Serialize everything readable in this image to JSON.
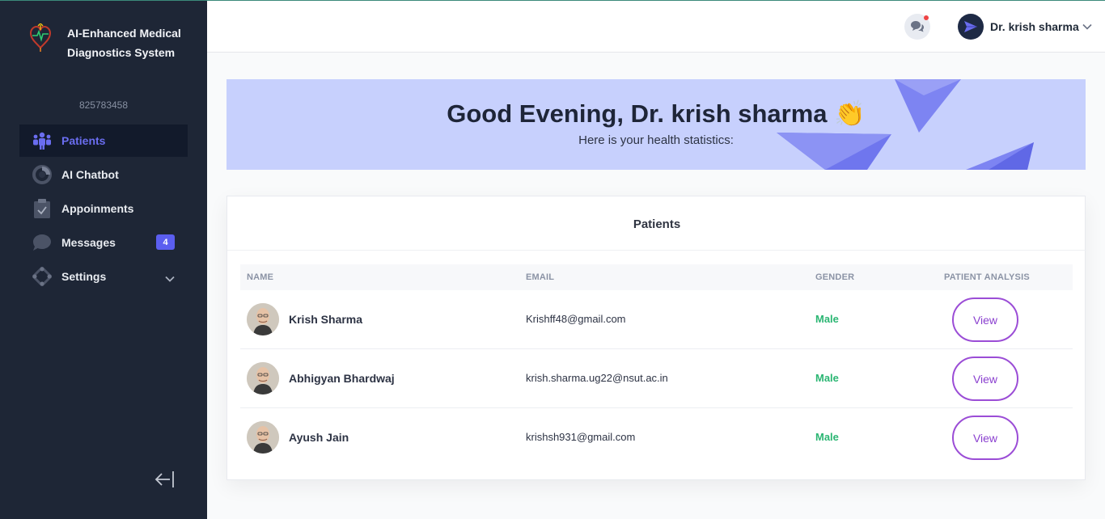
{
  "brand": {
    "title": "AI-Enhanced Medical Diagnostics System"
  },
  "sidebar": {
    "id_text": "825783458",
    "items": [
      {
        "label": "Patients",
        "icon": "patients-icon",
        "active": true
      },
      {
        "label": "AI Chatbot",
        "icon": "chart-pie-icon"
      },
      {
        "label": "Appoinments",
        "icon": "clipboard-check-icon"
      },
      {
        "label": "Messages",
        "icon": "chat-bubble-icon",
        "badge": "4"
      },
      {
        "label": "Settings",
        "icon": "settings-icon"
      }
    ]
  },
  "header": {
    "user_name": "Dr. krish sharma"
  },
  "banner": {
    "greeting": "Good Evening, Dr. krish sharma 👏",
    "subtitle": "Here is your health statistics:"
  },
  "patients": {
    "title": "Patients",
    "columns": {
      "name": "NAME",
      "email": "EMAIL",
      "gender": "GENDER",
      "analysis": "PATIENT ANALYSIS"
    },
    "rows": [
      {
        "name": "Krish Sharma",
        "email": "Krishff48@gmail.com",
        "gender": "Male",
        "action": "View"
      },
      {
        "name": "Abhigyan Bhardwaj",
        "email": "krish.sharma.ug22@nsut.ac.in",
        "gender": "Male",
        "action": "View"
      },
      {
        "name": "Ayush Jain",
        "email": "krishsh931@gmail.com",
        "gender": "Male",
        "action": "View"
      }
    ]
  },
  "colors": {
    "sidebar_bg": "#1e2636",
    "accent": "#5b5ef0",
    "banner_bg": "#c7d0fd",
    "male": "#2bb673",
    "view_border": "#9b4dd6"
  }
}
